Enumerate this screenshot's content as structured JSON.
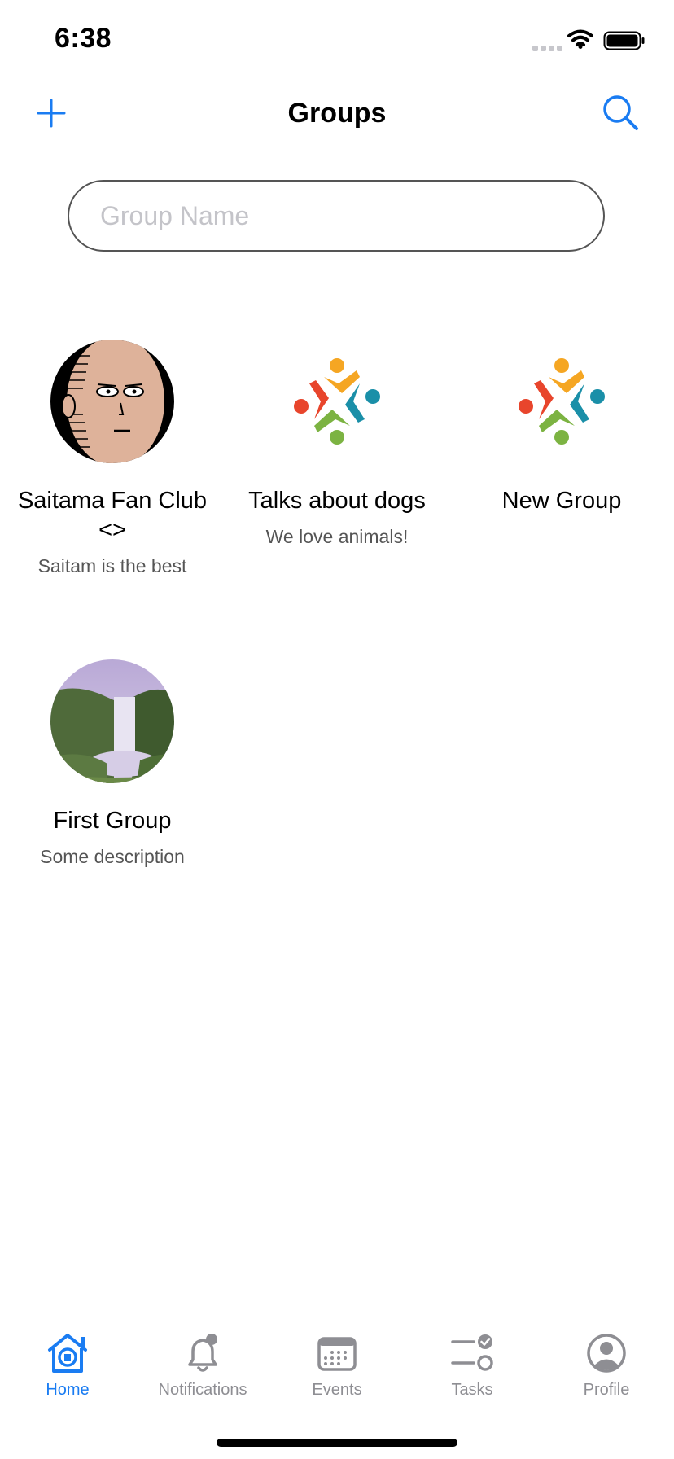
{
  "status_bar": {
    "time": "6:38"
  },
  "nav": {
    "title": "Groups",
    "add_icon": "plus-icon",
    "search_icon": "search-icon"
  },
  "search": {
    "placeholder": "Group Name",
    "value": ""
  },
  "groups": [
    {
      "name": "Saitama Fan Club <>",
      "description": "Saitam is the best",
      "avatar": "saitama-image"
    },
    {
      "name": "Talks about dogs",
      "description": "We love animals!",
      "avatar": "people-logo"
    },
    {
      "name": "New Group",
      "description": "",
      "avatar": "people-logo"
    },
    {
      "name": "First Group",
      "description": "Some description",
      "avatar": "waterfall-image"
    }
  ],
  "tabs": [
    {
      "label": "Home",
      "icon": "home-icon",
      "active": true
    },
    {
      "label": "Notifications",
      "icon": "bell-icon",
      "active": false
    },
    {
      "label": "Events",
      "icon": "calendar-icon",
      "active": false
    },
    {
      "label": "Tasks",
      "icon": "tasks-icon",
      "active": false
    },
    {
      "label": "Profile",
      "icon": "profile-icon",
      "active": false
    }
  ],
  "colors": {
    "accent": "#1a7cf2",
    "inactive": "#8e8e93"
  }
}
